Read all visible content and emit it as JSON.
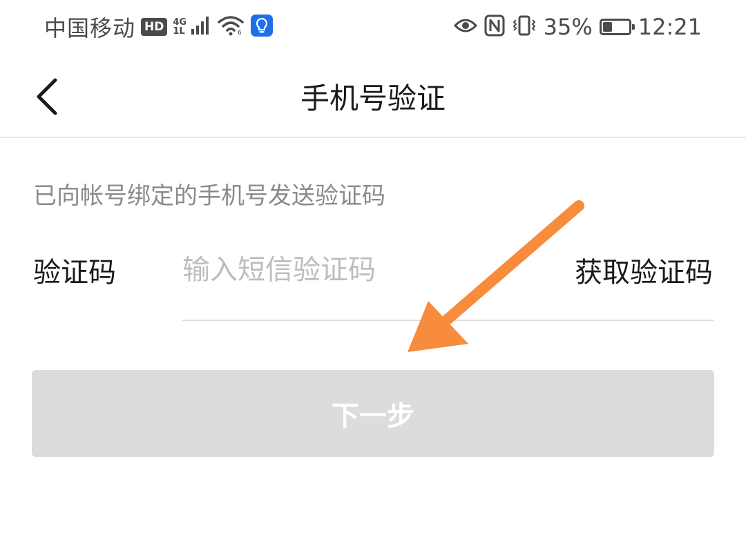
{
  "status_bar": {
    "carrier": "中国移动",
    "hd_badge": "HD",
    "network_type_top": "4G",
    "network_type_bottom": "1L",
    "battery_percent": "35%",
    "battery_level": 0.35,
    "time": "12:21",
    "icons": [
      "hd-icon",
      "signal-icon",
      "wifi-icon",
      "bulb-app-icon",
      "eye-icon",
      "nfc-icon",
      "vibrate-icon",
      "battery-icon"
    ]
  },
  "header": {
    "back_icon": "chevron-left-icon",
    "title": "手机号验证"
  },
  "form": {
    "hint": "已向帐号绑定的手机号发送验证码",
    "code_label": "验证码",
    "code_placeholder": "输入短信验证码",
    "code_value": "",
    "get_code_label": "获取验证码",
    "next_label": "下一步"
  },
  "colors": {
    "title_text": "#1a1a1a",
    "hint_text": "#8a8a8a",
    "placeholder": "#bdbdbd",
    "button_disabled_bg": "#dcdcde",
    "annotation_arrow": "#f78c3c",
    "wifi_app_badge": "#1e6fe8"
  }
}
